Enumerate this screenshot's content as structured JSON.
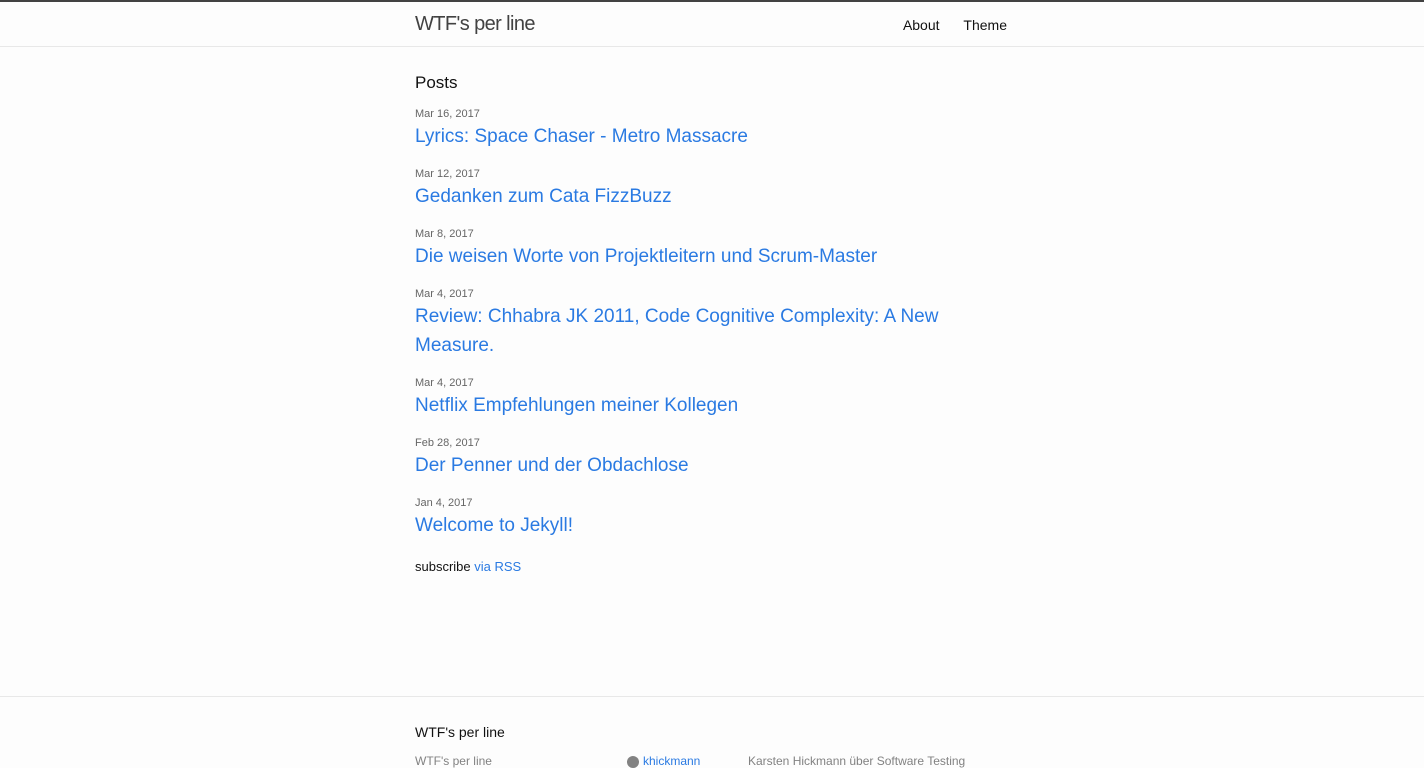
{
  "header": {
    "site_title": "WTF's per line",
    "nav": [
      "About",
      "Theme"
    ]
  },
  "main": {
    "heading": "Posts",
    "posts": [
      {
        "date": "Mar 16, 2017",
        "title": "Lyrics: Space Chaser - Metro Massacre"
      },
      {
        "date": "Mar 12, 2017",
        "title": "Gedanken zum Cata FizzBuzz"
      },
      {
        "date": "Mar 8, 2017",
        "title": "Die weisen Worte von Projektleitern und Scrum-Master"
      },
      {
        "date": "Mar 4, 2017",
        "title": "Review: Chhabra JK 2011, Code Cognitive Complexity: A New Measure."
      },
      {
        "date": "Mar 4, 2017",
        "title": "Netflix Empfehlungen meiner Kollegen"
      },
      {
        "date": "Feb 28, 2017",
        "title": "Der Penner und der Obdachlose"
      },
      {
        "date": "Jan 4, 2017",
        "title": "Welcome to Jekyll!"
      }
    ],
    "subscribe_text": "subscribe",
    "rss_link": "via RSS"
  },
  "footer": {
    "heading": "WTF's per line",
    "col1": "WTF's per line",
    "github_user": "khickmann",
    "description": "Karsten Hickmann über Software Testing"
  },
  "colors": {
    "link": "#2a7ae2",
    "header_border": "#424242",
    "background": "#fdfdfd"
  }
}
